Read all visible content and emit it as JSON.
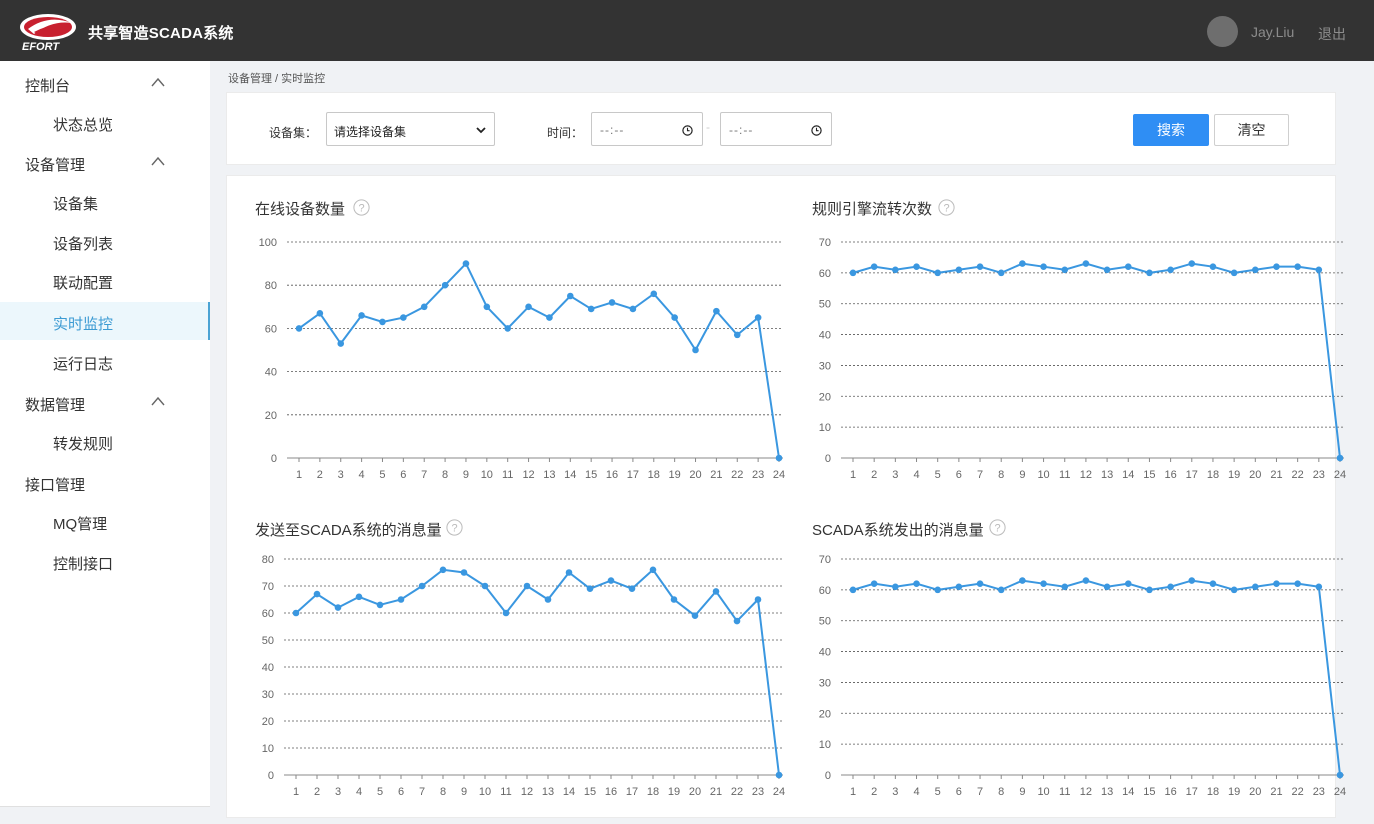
{
  "header": {
    "brand_text": "EFORT",
    "app_title": "共享智造SCADA系统",
    "username": "Jay.Liu",
    "logout_label": "退出"
  },
  "sidebar": {
    "groups": [
      {
        "label": "控制台",
        "items": [
          "状态总览"
        ]
      },
      {
        "label": "设备管理",
        "items": [
          "设备集",
          "设备列表",
          "联动配置",
          "实时监控",
          "运行日志"
        ]
      },
      {
        "label": "数据管理",
        "items": [
          "转发规则"
        ]
      },
      {
        "label": "接口管理",
        "items": [
          "MQ管理",
          "控制接口"
        ]
      }
    ],
    "active_item": "实时监控"
  },
  "breadcrumb": "设备管理 / 实时监控",
  "filters": {
    "device_set_label": "设备集：",
    "device_set_value": "请选择设备集",
    "time_label": "时间：",
    "time_start": "--:--",
    "time_end": "--:--",
    "time_separator": "-",
    "search_label": "搜索",
    "clear_label": "清空"
  },
  "colors": {
    "line": "#3a97e0",
    "accent": "#2f8ef4",
    "topbar": "#333333"
  },
  "chart_data": [
    {
      "type": "line",
      "title": "在线设备数量",
      "x": [
        1,
        2,
        3,
        4,
        5,
        6,
        7,
        8,
        9,
        10,
        11,
        12,
        13,
        14,
        15,
        16,
        17,
        18,
        19,
        20,
        21,
        22,
        23,
        24
      ],
      "y": [
        60,
        67,
        53,
        66,
        63,
        65,
        70,
        80,
        90,
        70,
        60,
        70,
        65,
        75,
        69,
        72,
        69,
        76,
        65,
        50,
        68,
        57,
        65,
        0
      ],
      "ylim": [
        0,
        100
      ],
      "yticks": [
        0,
        20,
        40,
        60,
        80,
        100
      ],
      "grid": true
    },
    {
      "type": "line",
      "title": "规则引擎流转次数",
      "x": [
        1,
        2,
        3,
        4,
        5,
        6,
        7,
        8,
        9,
        10,
        11,
        12,
        13,
        14,
        15,
        16,
        17,
        18,
        19,
        20,
        21,
        22,
        23,
        24
      ],
      "y": [
        60,
        62,
        61,
        62,
        60,
        61,
        62,
        60,
        63,
        62,
        61,
        63,
        61,
        62,
        60,
        61,
        63,
        62,
        60,
        61,
        62,
        62,
        61,
        0
      ],
      "ylim": [
        0,
        70
      ],
      "yticks": [
        0,
        10,
        20,
        30,
        40,
        50,
        60,
        70
      ],
      "grid": true
    },
    {
      "type": "line",
      "title": "发送至SCADA系统的消息量",
      "x": [
        1,
        2,
        3,
        4,
        5,
        6,
        7,
        8,
        9,
        10,
        11,
        12,
        13,
        14,
        15,
        16,
        17,
        18,
        19,
        20,
        21,
        22,
        23,
        24
      ],
      "y": [
        60,
        67,
        62,
        66,
        63,
        65,
        70,
        76,
        75,
        70,
        60,
        70,
        65,
        75,
        69,
        72,
        69,
        76,
        65,
        59,
        68,
        57,
        65,
        0
      ],
      "ylim": [
        0,
        80
      ],
      "yticks": [
        0,
        10,
        20,
        30,
        40,
        50,
        60,
        70,
        80
      ],
      "grid": true
    },
    {
      "type": "line",
      "title": "SCADA系统发出的消息量",
      "x": [
        1,
        2,
        3,
        4,
        5,
        6,
        7,
        8,
        9,
        10,
        11,
        12,
        13,
        14,
        15,
        16,
        17,
        18,
        19,
        20,
        21,
        22,
        23,
        24
      ],
      "y": [
        60,
        62,
        61,
        62,
        60,
        61,
        62,
        60,
        63,
        62,
        61,
        63,
        61,
        62,
        60,
        61,
        63,
        62,
        60,
        61,
        62,
        62,
        61,
        0
      ],
      "ylim": [
        0,
        70
      ],
      "yticks": [
        0,
        10,
        20,
        30,
        40,
        50,
        60,
        70
      ],
      "grid": true
    }
  ]
}
